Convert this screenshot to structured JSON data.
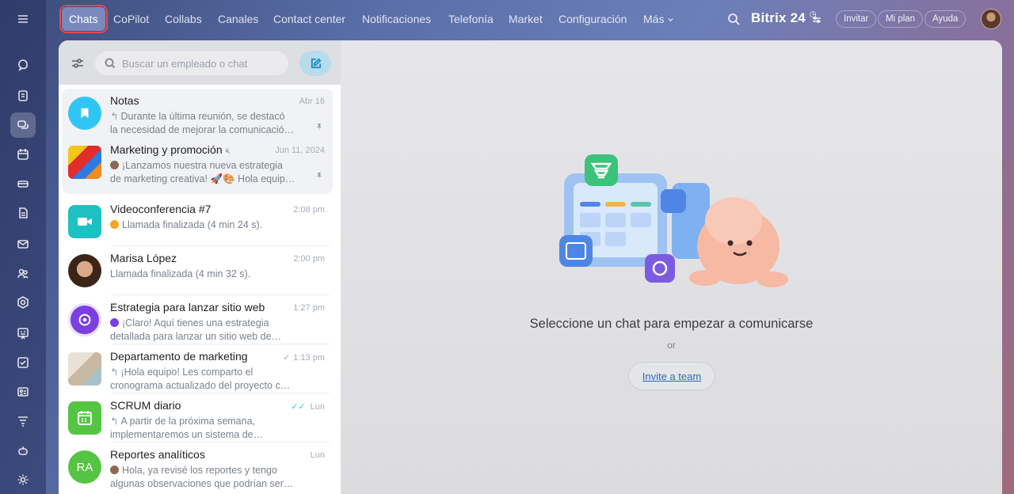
{
  "nav": {
    "tabs": [
      "Chats",
      "CoPilot",
      "Collabs",
      "Canales",
      "Contact center",
      "Notificaciones",
      "Telefonía",
      "Market",
      "Configuración",
      "Más"
    ],
    "brand": "Bitrix 24",
    "invite": "Invitar",
    "plan": "Mi plan",
    "help": "Ayuda"
  },
  "sidebar_icons": [
    "chat-bubble-icon",
    "feed-icon",
    "messenger-icon",
    "calendar-icon",
    "drive-icon",
    "document-icon",
    "mail-icon",
    "users-icon",
    "hexagon-icon",
    "board-icon",
    "checkbox-icon",
    "contact-card-icon",
    "filter-icon",
    "robot-icon",
    "settings-icon"
  ],
  "search": {
    "placeholder": "Buscar un empleado o chat"
  },
  "chats": [
    {
      "title": "Notas",
      "time": "Abr 16",
      "line1": "Durante la última reunión, se destacó",
      "line2": "la necesidad de mejorar la comunicació…",
      "pinned": true
    },
    {
      "title": "Marketing y promoción",
      "time": "Jun 11, 2024",
      "line1": "¡Lanzamos nuestra nueva estrategia",
      "line2": "de marketing creativa! 🚀🎨 Hola equipo…",
      "pinned": true
    },
    {
      "title": "Videoconferencia #7",
      "time": "2:08 pm",
      "line1": "Llamada finalizada (4 min 24 s).",
      "line2": ""
    },
    {
      "title": "Marisa López",
      "time": "2:00 pm",
      "line1": "Llamada finalizada (4 min 32 s).",
      "line2": ""
    },
    {
      "title": "Estrategia para lanzar sitio web",
      "time": "1:27 pm",
      "line1": "¡Claro! Aquí tienes una estrategia",
      "line2": "detallada para lanzar un sitio web de…"
    },
    {
      "title": "Departamento de marketing",
      "time": "1:13 pm",
      "line1": "¡Hola equipo! Les comparto el",
      "line2": "cronograma actualizado del proyecto c…"
    },
    {
      "title": "SCRUM diario",
      "time": "Lun",
      "line1": "A partir de la próxima semana,",
      "line2": "implementaremos un sistema de…"
    },
    {
      "title": "Reportes analíticos",
      "time": "Lun",
      "line1": "Hola, ya revisé los reportes y tengo",
      "line2": "algunas observaciones que podrían ser…",
      "initials": "RA"
    }
  ],
  "empty_state": {
    "message": "Seleccione un chat para empezar a comunicarse",
    "or": "or",
    "invite": "Invite a team"
  },
  "colors": {
    "accent": "#2fc6f6",
    "highlight": "#e5484d"
  }
}
